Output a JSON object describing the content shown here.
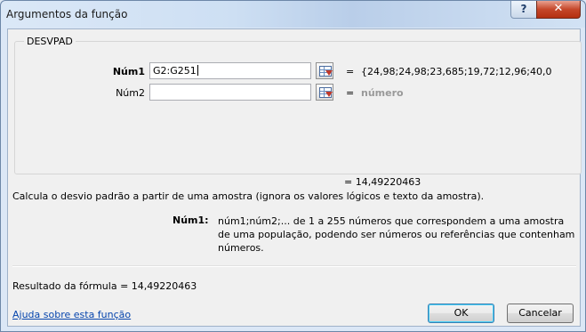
{
  "window": {
    "title": "Argumentos da função",
    "help_glyph": "?",
    "close_glyph": "✕"
  },
  "function_group": {
    "name": "DESVPAD",
    "args": [
      {
        "label": "Núm1",
        "value": "G2:G251",
        "result": "{24,98;24,98;23,685;19,72;12,96;40,0"
      },
      {
        "label": "Núm2",
        "value": "",
        "result": "número"
      }
    ]
  },
  "equals_sign": "=",
  "function_result": "= 14,49220463",
  "description": "Calcula o desvio padrão a partir de uma amostra (ignora os valores lógicos e texto da amostra).",
  "arg_help": {
    "label": "Núm1:",
    "text": "núm1;núm2;... de 1 a 255 números que correspondem a uma amostra de uma população, podendo ser números ou referências que contenham números."
  },
  "formula_result": "Resultado da fórmula =  14,49220463",
  "help_link": "Ajuda sobre esta função",
  "buttons": {
    "ok": "OK",
    "cancel": "Cancelar"
  },
  "icons": {
    "ref_button": "collapse-dialog-icon"
  }
}
